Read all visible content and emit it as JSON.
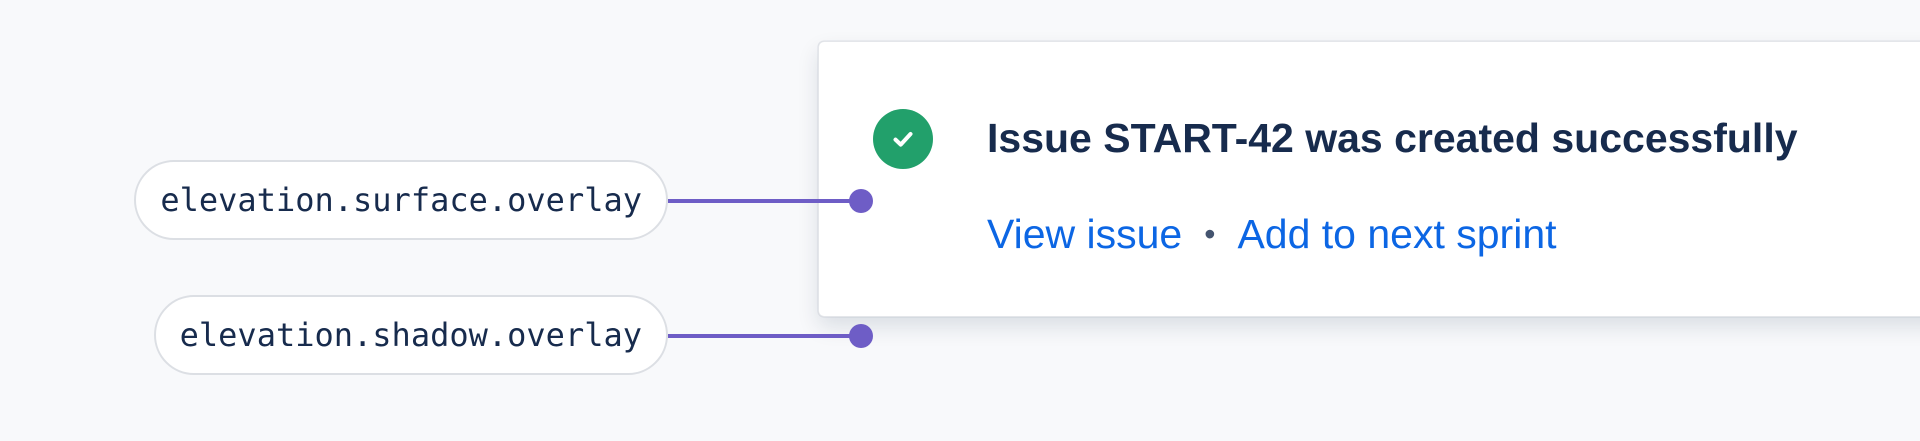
{
  "tokens": {
    "surface_label": "elevation.surface.overlay",
    "shadow_label": "elevation.shadow.overlay"
  },
  "flag": {
    "title": "Issue START-42 was created successfully",
    "icon": "check-circle-icon",
    "status_color": "#22a06b",
    "actions": {
      "view_issue": "View issue",
      "separator": "•",
      "add_to_sprint": "Add to next sprint"
    }
  },
  "colors": {
    "connector": "#6e5dc6",
    "link": "#0c66e4",
    "text": "#172b4d"
  }
}
